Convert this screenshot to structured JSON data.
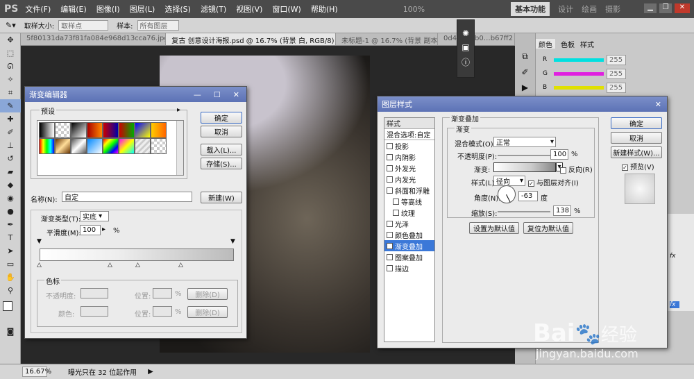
{
  "app": {
    "logo": "PS",
    "menus": [
      "文件(F)",
      "编辑(E)",
      "图像(I)",
      "图层(L)",
      "选择(S)",
      "滤镜(T)",
      "视图(V)",
      "窗口(W)",
      "帮助(H)"
    ],
    "zoom": "100%",
    "workspaces": [
      "基本功能",
      "设计",
      "绘画",
      "摄影"
    ]
  },
  "options": {
    "sample_size_label": "取样大小:",
    "sample_size_value": "取样点",
    "sample_label": "样本:",
    "sample_value": "所有图层"
  },
  "tabs": [
    "5f80131da73f81fa084e968d13cca76.jpg",
    "复古 创意设计海报.psd @ 16.7% (背景 白, RGB/8) *",
    "未标题-1 @ 16.7% (背景 副本",
    "0d45d2ffb0…b67ff2"
  ],
  "status": {
    "zoom": "16.67%",
    "message": "曝光只在 32 位起作用"
  },
  "gradient_editor": {
    "title": "渐变编辑器",
    "presets_label": "预设",
    "ok": "确定",
    "cancel": "取消",
    "load": "载入(L)...",
    "save": "存储(S)...",
    "name_label": "名称(N):",
    "name_value": "自定",
    "new_button": "新建(W)",
    "type_label": "渐变类型(T):",
    "type_value": "实底",
    "smooth_label": "平滑度(M):",
    "smooth_value": "100",
    "smooth_unit": "%",
    "stops_label": "色标",
    "opacity_label": "不透明度:",
    "color_label": "颜色:",
    "location_label": "位置:",
    "location_unit": "%",
    "delete_label": "删除(D)"
  },
  "layer_style": {
    "title": "图层样式",
    "styles_header": "样式",
    "blend_options": "混合选项:自定",
    "items": [
      {
        "label": "投影",
        "checked": false,
        "indent": false
      },
      {
        "label": "内阴影",
        "checked": false,
        "indent": false
      },
      {
        "label": "外发光",
        "checked": false,
        "indent": false
      },
      {
        "label": "内发光",
        "checked": false,
        "indent": false
      },
      {
        "label": "斜面和浮雕",
        "checked": false,
        "indent": false
      },
      {
        "label": "等高线",
        "checked": false,
        "indent": true
      },
      {
        "label": "纹理",
        "checked": false,
        "indent": true
      },
      {
        "label": "光泽",
        "checked": false,
        "indent": false
      },
      {
        "label": "颜色叠加",
        "checked": false,
        "indent": false
      },
      {
        "label": "渐变叠加",
        "checked": true,
        "indent": false,
        "selected": true
      },
      {
        "label": "图案叠加",
        "checked": false,
        "indent": false
      },
      {
        "label": "描边",
        "checked": false,
        "indent": false
      }
    ],
    "section_title": "渐变叠加",
    "sub_title": "渐变",
    "blend_mode_label": "混合模式(O):",
    "blend_mode_value": "正常",
    "opacity_label": "不透明度(P):",
    "opacity_value": "100",
    "opacity_unit": "%",
    "gradient_label": "渐变:",
    "reverse_label": "反向(R)",
    "style_label": "样式(L):",
    "style_value": "径向",
    "align_label": "与图层对齐(I)",
    "angle_label": "角度(N):",
    "angle_value": "-63",
    "angle_unit": "度",
    "scale_label": "缩放(S):",
    "scale_value": "138",
    "scale_unit": "%",
    "set_default": "设置为默认值",
    "reset_default": "复位为默认值",
    "ok": "确定",
    "cancel": "取消",
    "new_style": "新建样式(W)...",
    "preview_label": "预览(V)"
  },
  "color_panel": {
    "tabs": [
      "颜色",
      "色板",
      "样式"
    ],
    "rows": [
      {
        "label": "R",
        "value": "255",
        "color": "#00e0e0"
      },
      {
        "label": "G",
        "value": "255",
        "color": "#e020e0"
      },
      {
        "label": "B",
        "value": "255",
        "color": "#e0e000"
      }
    ]
  },
  "watermark": {
    "brand": "Bai",
    "brand2": "经验",
    "url": "jingyan.baidu.com"
  }
}
